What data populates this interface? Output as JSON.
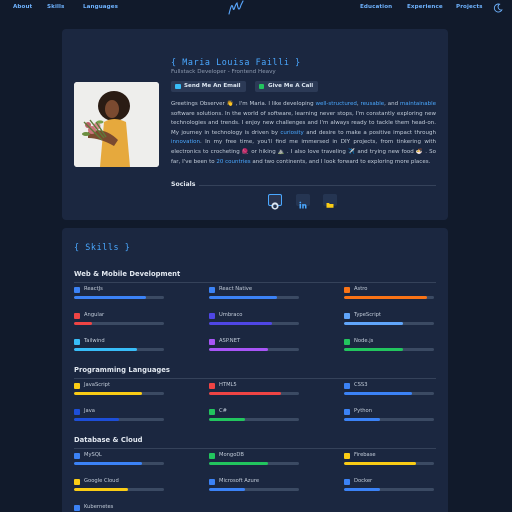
{
  "nav": {
    "left": [
      "About",
      "Skills",
      "Languages"
    ],
    "right": [
      "Education",
      "Experience",
      "Projects"
    ]
  },
  "hero": {
    "name": "{ Maria Louisa Failli }",
    "role": "Fullstack Developer - Frontend Heavy",
    "buttons": [
      "Send Me An Email",
      "Give Me A Call"
    ],
    "bio": [
      {
        "t": "Greetings Observer 👋 , I'm Maria. I like developing "
      },
      {
        "t": "well-structured",
        "hl": true
      },
      {
        "t": ", "
      },
      {
        "t": "reusable",
        "hl": true
      },
      {
        "t": ", and "
      },
      {
        "t": "maintainable",
        "hl": true
      },
      {
        "t": " software solutions. In the world of software, learning never stops, I'm constantly exploring new technologies and trends. I enjoy new challenges and I'm always ready to tackle them head-on. My journey in technology is driven by "
      },
      {
        "t": "curiosity",
        "hl": true
      },
      {
        "t": " and desire to make a positive impact through "
      },
      {
        "t": "innovation",
        "hl": true
      },
      {
        "t": ". In my free time, you'll find me immersed in DIY projects, from tinkering with electronics to crocheting 🧶 or hiking ⛰️ . I also love traveling ✈️ and trying new food 🍜 . So far, I've been to "
      },
      {
        "t": "20 countries",
        "hl": true
      },
      {
        "t": " and two continents, and I look forward to exploring more places."
      }
    ],
    "socials_label": "Socials",
    "socials": [
      "github-icon",
      "linkedin-icon",
      "folder-icon"
    ]
  },
  "skills": {
    "title": "{ Skills }",
    "categories": [
      {
        "name": "Web & Mobile Development",
        "items": [
          {
            "name": "ReactJs",
            "level": 0.8,
            "color": "#3b82f6",
            "icon": "react-icon"
          },
          {
            "name": "React Native",
            "level": 0.75,
            "color": "#3b82f6",
            "icon": "react-native-icon"
          },
          {
            "name": "Astro",
            "level": 0.92,
            "color": "#f97316",
            "icon": "astro-icon"
          },
          {
            "name": "Angular",
            "level": 0.2,
            "color": "#ef4444",
            "icon": "angular-icon"
          },
          {
            "name": "Umbraco",
            "level": 0.7,
            "color": "#4f46e5",
            "icon": "umbraco-icon"
          },
          {
            "name": "TypeScript",
            "level": 0.65,
            "color": "#60a5fa",
            "icon": "typescript-icon"
          },
          {
            "name": "Tailwind",
            "level": 0.7,
            "color": "#38bdf8",
            "icon": "tailwind-icon"
          },
          {
            "name": "ASP.NET",
            "level": 0.65,
            "color": "#a855f7",
            "icon": "aspnet-icon"
          },
          {
            "name": "Node.js",
            "level": 0.65,
            "color": "#22c55e",
            "icon": "nodejs-icon"
          }
        ]
      },
      {
        "name": "Programming Languages",
        "items": [
          {
            "name": "JavaScript",
            "level": 0.75,
            "color": "#facc15",
            "icon": "javascript-icon"
          },
          {
            "name": "HTML5",
            "level": 0.8,
            "color": "#ef4444",
            "icon": "html5-icon"
          },
          {
            "name": "CSS3",
            "level": 0.75,
            "color": "#3b82f6",
            "icon": "css3-icon"
          },
          {
            "name": "Java",
            "level": 0.5,
            "color": "#1d4ed8",
            "icon": "java-icon"
          },
          {
            "name": "C#",
            "level": 0.4,
            "color": "#22c55e",
            "icon": "csharp-icon"
          },
          {
            "name": "Python",
            "level": 0.4,
            "color": "#3b82f6",
            "icon": "python-icon"
          }
        ]
      },
      {
        "name": "Database & Cloud",
        "items": [
          {
            "name": "MySQL",
            "level": 0.75,
            "color": "#3b82f6",
            "icon": "mysql-icon"
          },
          {
            "name": "MongoDB",
            "level": 0.65,
            "color": "#22c55e",
            "icon": "mongodb-icon"
          },
          {
            "name": "Firebase",
            "level": 0.8,
            "color": "#facc15",
            "icon": "firebase-icon"
          },
          {
            "name": "Google Cloud",
            "level": 0.6,
            "color": "#facc15",
            "icon": "google-cloud-icon"
          },
          {
            "name": "Microsoft Azure",
            "level": 0.4,
            "color": "#3b82f6",
            "icon": "azure-icon"
          },
          {
            "name": "Docker",
            "level": 0.4,
            "color": "#3b82f6",
            "icon": "docker-icon"
          },
          {
            "name": "Kubernetes",
            "level": 0.3,
            "color": "#3b82f6",
            "icon": "kubernetes-icon"
          }
        ]
      }
    ]
  }
}
